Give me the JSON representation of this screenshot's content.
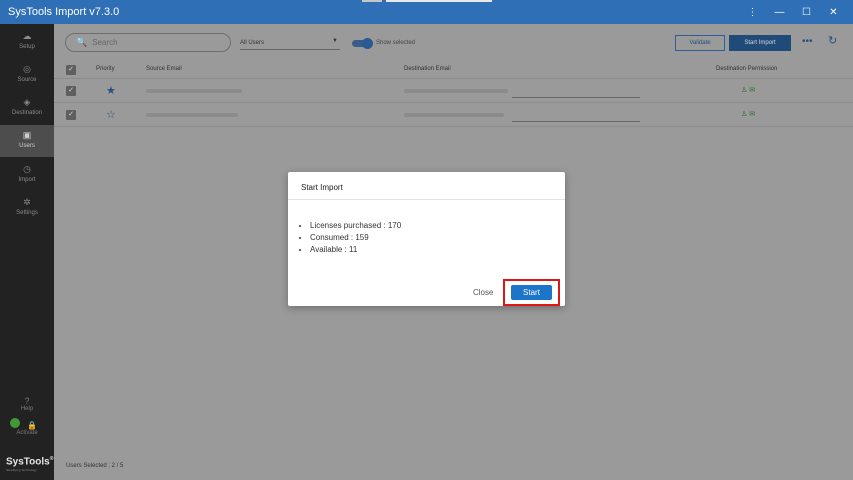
{
  "app": {
    "title": "SysTools Import v7.3.0",
    "window_controls": [
      "⋮",
      "—",
      "☐",
      "✕"
    ]
  },
  "sidebar": {
    "items": [
      {
        "label": "Setup",
        "icon": "cloud-icon",
        "glyph": "☁"
      },
      {
        "label": "Source",
        "icon": "source-icon",
        "glyph": "◎"
      },
      {
        "label": "Destination",
        "icon": "destination-icon",
        "glyph": "◈"
      },
      {
        "label": "Users",
        "icon": "users-icon",
        "glyph": "▣",
        "active": true
      },
      {
        "label": "Import",
        "icon": "import-icon",
        "glyph": "◷"
      },
      {
        "label": "Settings",
        "icon": "gear-icon",
        "glyph": "✲"
      }
    ],
    "help_label": "Help",
    "help_glyph": "?",
    "activate_label": "Activate",
    "lock_glyph": "🔒",
    "brand_name": "SysTools",
    "brand_reg": "®",
    "brand_tagline": "Simplifying Technology"
  },
  "toolbar": {
    "search_placeholder": "Search",
    "search_glyph": "🔍",
    "filter_value": "All Users",
    "filter_chevron": "▼",
    "show_selected_label": "Show selected",
    "validate_label": "Validate",
    "start_import_label": "Start Import",
    "more_glyph": "•••",
    "refresh_glyph": "↻"
  },
  "table": {
    "columns": [
      "Priority",
      "Source Email",
      "Destination Email",
      "Destination Permission"
    ],
    "header_check": "✓",
    "rows": [
      {
        "check": "✓",
        "star": "★",
        "perm": "♙ ✉"
      },
      {
        "check": "✓",
        "star": "☆",
        "perm": "♙ ✉"
      }
    ]
  },
  "status": {
    "users_selected": "Users Selected : 2 / 5"
  },
  "modal": {
    "title": "Start Import",
    "items": [
      "Licenses purchased : 170",
      "Consumed : 159",
      "Available : 11"
    ],
    "close_label": "Close",
    "start_label": "Start"
  },
  "colors": {
    "titlebar": "#2e6fb6",
    "sidebar": "#222222",
    "accent": "#1c75c9",
    "highlight": "#e01515"
  }
}
